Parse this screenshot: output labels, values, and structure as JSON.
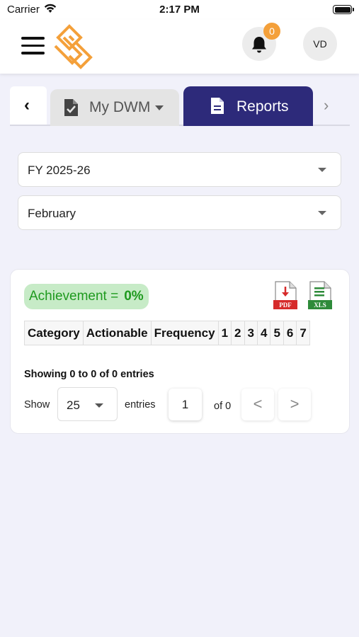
{
  "status_bar": {
    "carrier": "Carrier",
    "time": "2:17 PM"
  },
  "header": {
    "notification_count": "0",
    "avatar_initials": "VD",
    "brand_color": "#f4a03a"
  },
  "tabs": {
    "my_dwm_label": "My DWM",
    "reports_label": "Reports",
    "active_tab": "Reports",
    "active_color": "#2d2a7a"
  },
  "filters": {
    "fiscal_year": "FY 2025-26",
    "month": "February"
  },
  "report_card": {
    "achievement_label": "Achievement =",
    "achievement_value": "0%",
    "pdf_label": "PDF",
    "xls_label": "XLS",
    "columns": [
      "Category",
      "Actionable",
      "Frequency",
      "1",
      "2",
      "3",
      "4",
      "5",
      "6",
      "7"
    ],
    "showing_text": "Showing 0 to 0 of 0 entries",
    "show_label": "Show",
    "page_size": "25",
    "entries_label": "entries",
    "current_page": "1",
    "of_pages": "of 0",
    "prev_label": "<",
    "next_label": ">"
  }
}
